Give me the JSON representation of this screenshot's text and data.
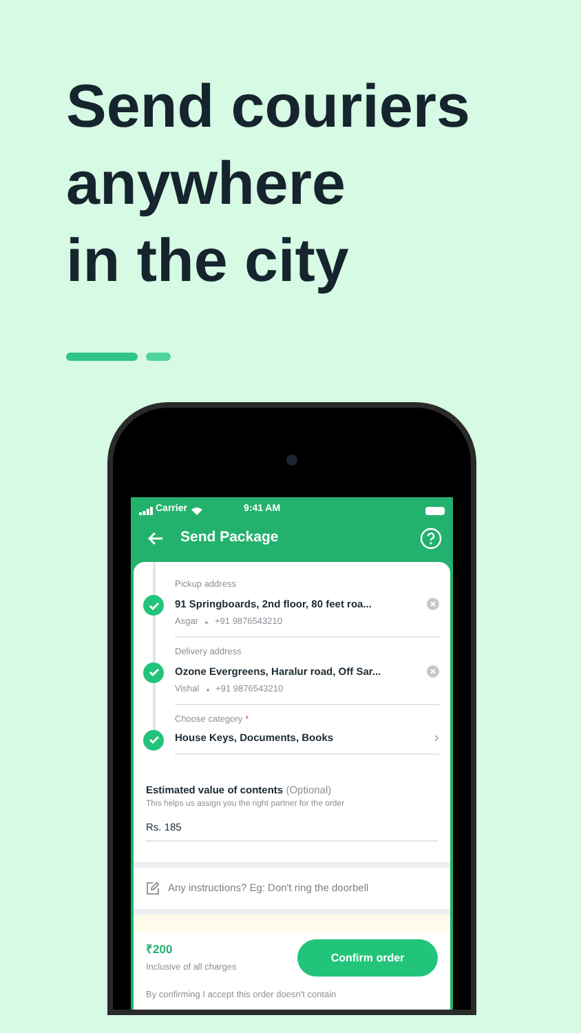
{
  "headline_lines": [
    "Send couriers",
    "anywhere",
    "in the city"
  ],
  "pager": [
    {
      "selected": true
    },
    {
      "selected": false
    }
  ],
  "status_bar": {
    "carrier": "Carrier",
    "time": "9:41 AM"
  },
  "header": {
    "title": "Send Package"
  },
  "steps": [
    {
      "kind": "address",
      "done": true,
      "label": "Pickup address",
      "value": "91 Springboards, 2nd floor, 80 feet roa...",
      "contact_name": "Asgar",
      "contact_phone": "+91 9876543210"
    },
    {
      "kind": "address",
      "done": true,
      "label": "Delivery address",
      "value": "Ozone Evergreens, Haralur road, Off Sar...",
      "contact_name": "Vishal",
      "contact_phone": "+91 9876543210"
    },
    {
      "kind": "category",
      "done": true,
      "label": "Choose category",
      "required_mark": "*",
      "value": "House Keys, Documents, Books"
    }
  ],
  "estimate": {
    "title": "Estimated value of contents",
    "optional": "(Optional)",
    "hint": "This helps us assign you the right partner for the order",
    "value": "Rs. 185"
  },
  "instructions": {
    "placeholder": "Any instructions? Eg: Don't ring the doorbell"
  },
  "footer": {
    "price": "₹200",
    "price_note": "Inclusive of all charges",
    "button": "Confirm order",
    "disclaimer": "By confirming I accept this order doesn't contain"
  }
}
